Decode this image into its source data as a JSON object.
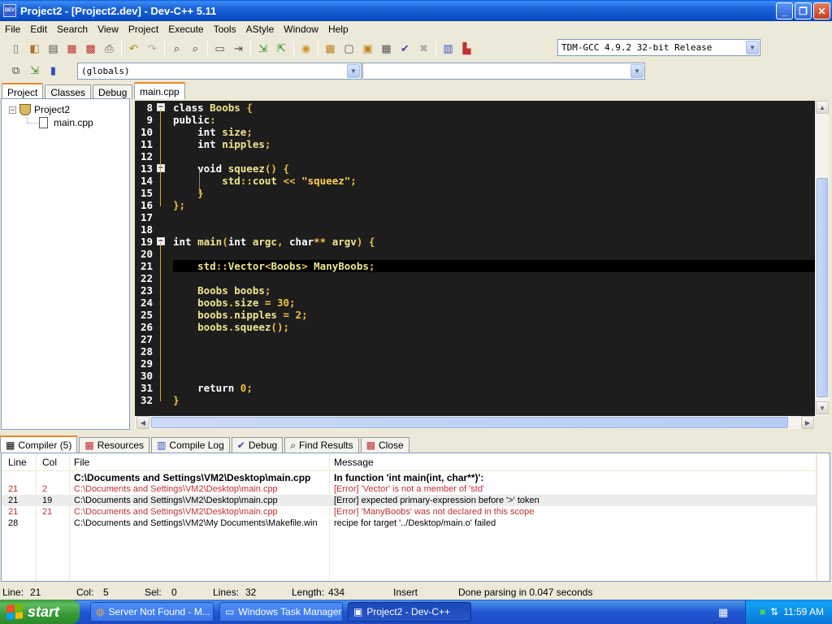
{
  "window": {
    "title": "Project2 - [Project2.dev] - Dev-C++ 5.11",
    "icon_text": "DEV"
  },
  "menu": [
    "File",
    "Edit",
    "Search",
    "View",
    "Project",
    "Execute",
    "Tools",
    "AStyle",
    "Window",
    "Help"
  ],
  "toolbar": {
    "compiler_select": "TDM-GCC 4.9.2 32-bit Release",
    "scope_select": "(globals)",
    "member_select": ""
  },
  "left_tabs": [
    "Project",
    "Classes",
    "Debug"
  ],
  "tree": {
    "project": "Project2",
    "file": "main.cpp"
  },
  "editor_tab": "main.cpp",
  "code_lines": [
    {
      "n": "8",
      "tokens": [
        [
          "kw",
          "class "
        ],
        [
          "id",
          "Boobs "
        ],
        [
          "sym",
          "{"
        ]
      ],
      "fold": "box"
    },
    {
      "n": "9",
      "tokens": [
        [
          "kw",
          "public"
        ],
        [
          "sym",
          ":"
        ]
      ]
    },
    {
      "n": "10",
      "tokens": [
        [
          "kw",
          "    int "
        ],
        [
          "id",
          "size"
        ],
        [
          "sym",
          ";"
        ]
      ]
    },
    {
      "n": "11",
      "tokens": [
        [
          "kw",
          "    int "
        ],
        [
          "id",
          "nipples"
        ],
        [
          "sym",
          ";"
        ]
      ]
    },
    {
      "n": "12",
      "tokens": []
    },
    {
      "n": "13",
      "tokens": [
        [
          "kw",
          "    void "
        ],
        [
          "id",
          "squeez"
        ],
        [
          "sym",
          "() {"
        ]
      ],
      "fold": "box"
    },
    {
      "n": "14",
      "tokens": [
        [
          "id",
          "        std"
        ],
        [
          "sym",
          "::"
        ],
        [
          "id",
          "cout "
        ],
        [
          "sym",
          "<< "
        ],
        [
          "str",
          "\"squeez\""
        ],
        [
          "sym",
          ";"
        ]
      ]
    },
    {
      "n": "15",
      "tokens": [
        [
          "sym",
          "    }"
        ]
      ]
    },
    {
      "n": "16",
      "tokens": [
        [
          "sym",
          "};"
        ]
      ]
    },
    {
      "n": "17",
      "tokens": []
    },
    {
      "n": "18",
      "tokens": []
    },
    {
      "n": "19",
      "tokens": [
        [
          "kw",
          "int "
        ],
        [
          "id",
          "main"
        ],
        [
          "sym",
          "("
        ],
        [
          "kw",
          "int "
        ],
        [
          "id",
          "argc"
        ],
        [
          "sym",
          ", "
        ],
        [
          "kw",
          "char"
        ],
        [
          "sym",
          "** "
        ],
        [
          "id",
          "argv"
        ],
        [
          "sym",
          ") {"
        ]
      ],
      "fold": "box"
    },
    {
      "n": "20",
      "tokens": []
    },
    {
      "n": "21",
      "tokens": [
        [
          "id",
          "    std"
        ],
        [
          "sym",
          "::"
        ],
        [
          "id",
          "Vector"
        ],
        [
          "sym",
          "<"
        ],
        [
          "id",
          "Boobs"
        ],
        [
          "sym",
          "> "
        ],
        [
          "id",
          "ManyBoobs"
        ],
        [
          "sym",
          ";"
        ]
      ]
    },
    {
      "n": "22",
      "tokens": []
    },
    {
      "n": "23",
      "tokens": [
        [
          "id",
          "    Boobs boobs"
        ],
        [
          "sym",
          ";"
        ]
      ]
    },
    {
      "n": "24",
      "tokens": [
        [
          "id",
          "    boobs"
        ],
        [
          "sym",
          "."
        ],
        [
          "id",
          "size "
        ],
        [
          "sym",
          "= "
        ],
        [
          "num",
          "30"
        ],
        [
          "sym",
          ";"
        ]
      ]
    },
    {
      "n": "25",
      "tokens": [
        [
          "id",
          "    boobs"
        ],
        [
          "sym",
          "."
        ],
        [
          "id",
          "nipples "
        ],
        [
          "sym",
          "= "
        ],
        [
          "num",
          "2"
        ],
        [
          "sym",
          ";"
        ]
      ]
    },
    {
      "n": "26",
      "tokens": [
        [
          "id",
          "    boobs"
        ],
        [
          "sym",
          "."
        ],
        [
          "id",
          "squeez"
        ],
        [
          "sym",
          "();"
        ]
      ]
    },
    {
      "n": "27",
      "tokens": []
    },
    {
      "n": "28",
      "tokens": []
    },
    {
      "n": "29",
      "tokens": []
    },
    {
      "n": "30",
      "tokens": []
    },
    {
      "n": "31",
      "tokens": [
        [
          "kw",
          "    return "
        ],
        [
          "num",
          "0"
        ],
        [
          "sym",
          ";"
        ]
      ]
    },
    {
      "n": "32",
      "tokens": [
        [
          "sym",
          "}"
        ]
      ]
    }
  ],
  "bottom_tabs": [
    "Compiler (5)",
    "Resources",
    "Compile Log",
    "Debug",
    "Find Results",
    "Close"
  ],
  "messages": {
    "headers": {
      "line": "Line",
      "col": "Col",
      "file": "File",
      "message": "Message"
    },
    "rows": [
      {
        "line": "",
        "col": "",
        "file": "C:\\Documents and Settings\\VM2\\Desktop\\main.cpp",
        "message": "In function 'int main(int, char**)':",
        "style": "bold"
      },
      {
        "line": "21",
        "col": "2",
        "file": "C:\\Documents and Settings\\VM2\\Desktop\\main.cpp",
        "message": "[Error] 'Vector' is not a member of 'std'",
        "style": "error"
      },
      {
        "line": "21",
        "col": "19",
        "file": "C:\\Documents and Settings\\VM2\\Desktop\\main.cpp",
        "message": "[Error] expected primary-expression before '>' token",
        "style": "selected"
      },
      {
        "line": "21",
        "col": "21",
        "file": "C:\\Documents and Settings\\VM2\\Desktop\\main.cpp",
        "message": "[Error] 'ManyBoobs' was not declared in this scope",
        "style": "error"
      },
      {
        "line": "28",
        "col": "",
        "file": "C:\\Documents and Settings\\VM2\\My Documents\\Makefile.win",
        "message": "recipe for target '../Desktop/main.o' failed",
        "style": "normal"
      }
    ]
  },
  "status": {
    "line_label": "Line:",
    "line": "21",
    "col_label": "Col:",
    "col": "5",
    "sel_label": "Sel:",
    "sel": "0",
    "lines_label": "Lines:",
    "lines": "32",
    "length_label": "Length:",
    "length": "434",
    "mode": "Insert",
    "parse": "Done parsing in 0.047 seconds"
  },
  "taskbar": {
    "start": "start",
    "tasks": [
      "Server Not Found - M...",
      "Windows Task Manager",
      "Project2 - Dev-C++"
    ],
    "clock": "11:59 AM"
  },
  "colors": {
    "error": "#c03030",
    "accent": "#e68b2c",
    "editor_bg": "#1d1d1d"
  }
}
